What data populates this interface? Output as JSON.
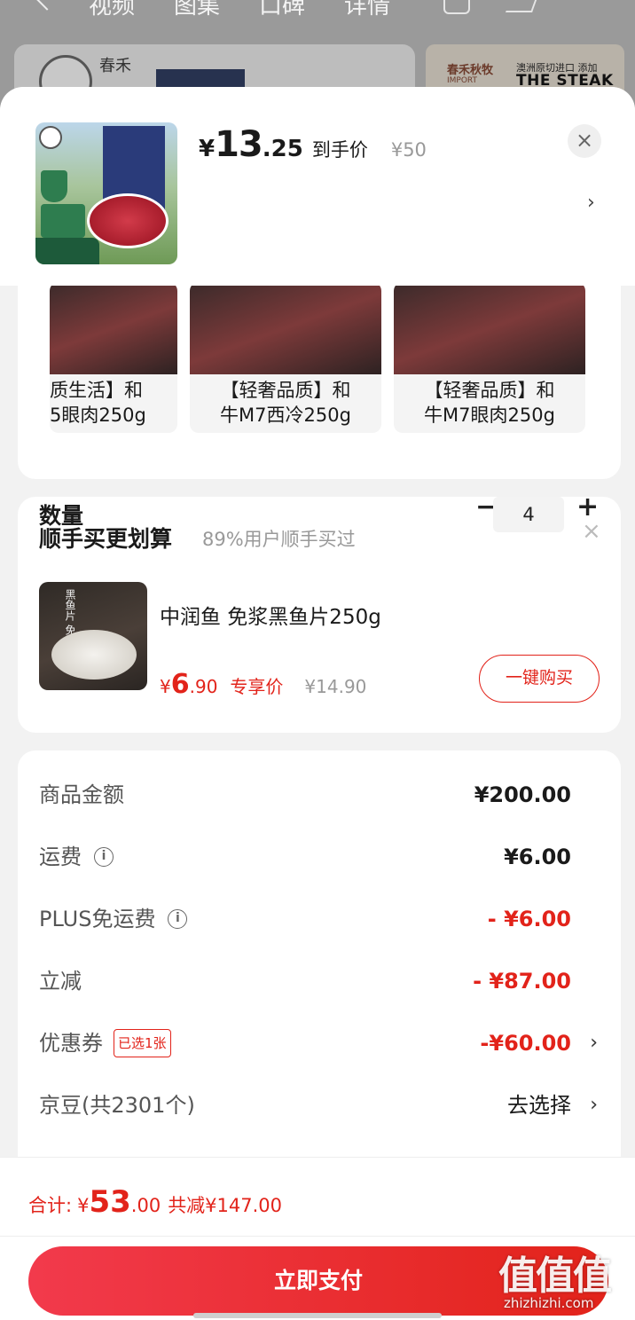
{
  "background": {
    "tabs": [
      "视频",
      "图集",
      "口碑",
      "详情"
    ],
    "brand_name": "春禾",
    "promo_brand": "春禾秋牧",
    "promo_brand_sub": "IMPORT",
    "promo_text": "澳洲原切进口 添加",
    "promo_title": "THE STEAK"
  },
  "header": {
    "price_currency": "¥",
    "price_integer": "13",
    "price_decimal": ".25",
    "price_tag": "到手价",
    "original_price": "¥50",
    "close_icon": "close-icon",
    "more_icon": "chevron-right-icon"
  },
  "variants": [
    {
      "label_line1": "质生活】和",
      "label_line2": "5眼肉250g"
    },
    {
      "label_line1": "【轻奢品质】和",
      "label_line2": "牛M7西冷250g"
    },
    {
      "label_line1": "【轻奢品质】和",
      "label_line2": "牛M7眼肉250g"
    }
  ],
  "quantity": {
    "label": "数量",
    "minus": "−",
    "value": "4",
    "plus": "+"
  },
  "upsell": {
    "title": "顺手买更划算",
    "subtitle": "89%用户顺手买过",
    "close": "×",
    "product_name": "中润鱼 免浆黑鱼片250g",
    "image_text": "黑鱼片 免浆",
    "price_currency": "¥",
    "price_integer": "6",
    "price_decimal": ".90",
    "price_tag": "专享价",
    "original_price": "¥14.90",
    "buy_label": "一键购买"
  },
  "summary": {
    "rows": [
      {
        "label": "商品金额",
        "value": "¥200.00"
      },
      {
        "label": "运费",
        "value": "¥6.00"
      },
      {
        "label": "PLUS免运费",
        "value": "- ¥6.00"
      },
      {
        "label": "立减",
        "value": "- ¥87.00"
      },
      {
        "label": "优惠券",
        "badge": "已选1张",
        "value": "-¥60.00"
      },
      {
        "label": "京豆(共2301个)",
        "value": "去选择"
      }
    ],
    "info_icon": "i",
    "arrow": "›"
  },
  "footer": {
    "total_label": "合计:",
    "total_currency": "¥",
    "total_integer": "53",
    "total_decimal": ".00",
    "savings": "共减¥147.00",
    "pay_label": "立即支付"
  },
  "watermark": {
    "main": "值值值",
    "sub": "zhizhizhi.com"
  },
  "colors": {
    "accent_red": "#e2231a",
    "text_dark": "#1a1a1a",
    "text_gray": "#999999"
  }
}
